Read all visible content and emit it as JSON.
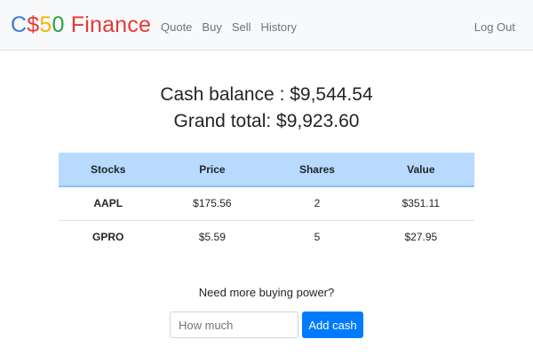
{
  "nav": {
    "brand": {
      "parts": [
        {
          "text": "C",
          "color": "#3b7bd9"
        },
        {
          "text": "$",
          "color": "#e53935"
        },
        {
          "text": "5",
          "color": "#f5b400"
        },
        {
          "text": "0",
          "color": "#2f9e44"
        },
        {
          "text": " Finance",
          "color": "#e53935"
        }
      ]
    },
    "links": [
      "Quote",
      "Buy",
      "Sell",
      "History"
    ],
    "logout": "Log Out"
  },
  "summary": {
    "cash_line": "Cash balance : $9,544.54",
    "total_line": "Grand total: $9,923.60"
  },
  "table": {
    "headers": [
      "Stocks",
      "Price",
      "Shares",
      "Value"
    ],
    "rows": [
      [
        "AAPL",
        "$175.56",
        "2",
        "$351.11"
      ],
      [
        "GPRO",
        "$5.59",
        "5",
        "$27.95"
      ]
    ]
  },
  "add_cash": {
    "prompt": "Need more buying power?",
    "placeholder": "How much",
    "button_label": "Add cash"
  },
  "colors": {
    "accent": "#007bff",
    "table_header": "#b8daff",
    "navbar_bg": "#f8f9fa"
  }
}
